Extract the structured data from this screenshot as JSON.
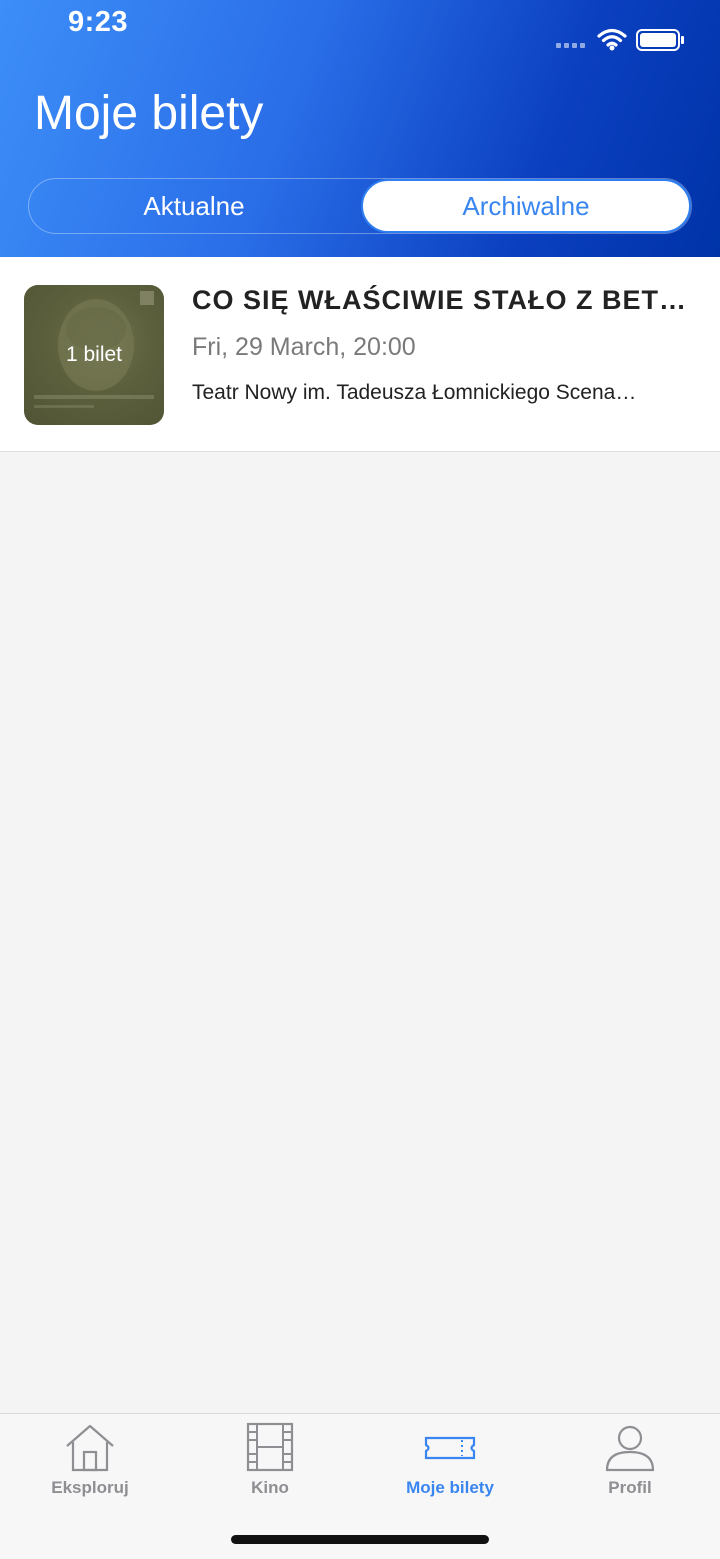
{
  "status_bar": {
    "time": "9:23"
  },
  "header": {
    "title": "Moje bilety",
    "segments": [
      {
        "label": "Aktualne",
        "selected": false
      },
      {
        "label": "Archiwalne",
        "selected": true
      }
    ]
  },
  "tickets": [
    {
      "title": "CO SIĘ WŁAŚCIWIE STAŁO Z BET…",
      "date": "Fri, 29 March, 20:00",
      "venue": "Teatr Nowy im. Tadeusza Łomnickiego Scena…",
      "badge": "1 bilet"
    }
  ],
  "tabbar": {
    "items": [
      {
        "label": "Eksploruj",
        "icon": "home-icon",
        "active": false
      },
      {
        "label": "Kino",
        "icon": "film-icon",
        "active": false
      },
      {
        "label": "Moje bilety",
        "icon": "ticket-icon",
        "active": true
      },
      {
        "label": "Profil",
        "icon": "profile-icon",
        "active": false
      }
    ]
  },
  "colors": {
    "accent": "#3a86f0",
    "header_start": "#3d8ef8",
    "header_end": "#0033a8",
    "inactive_tab": "#8e8e93"
  }
}
